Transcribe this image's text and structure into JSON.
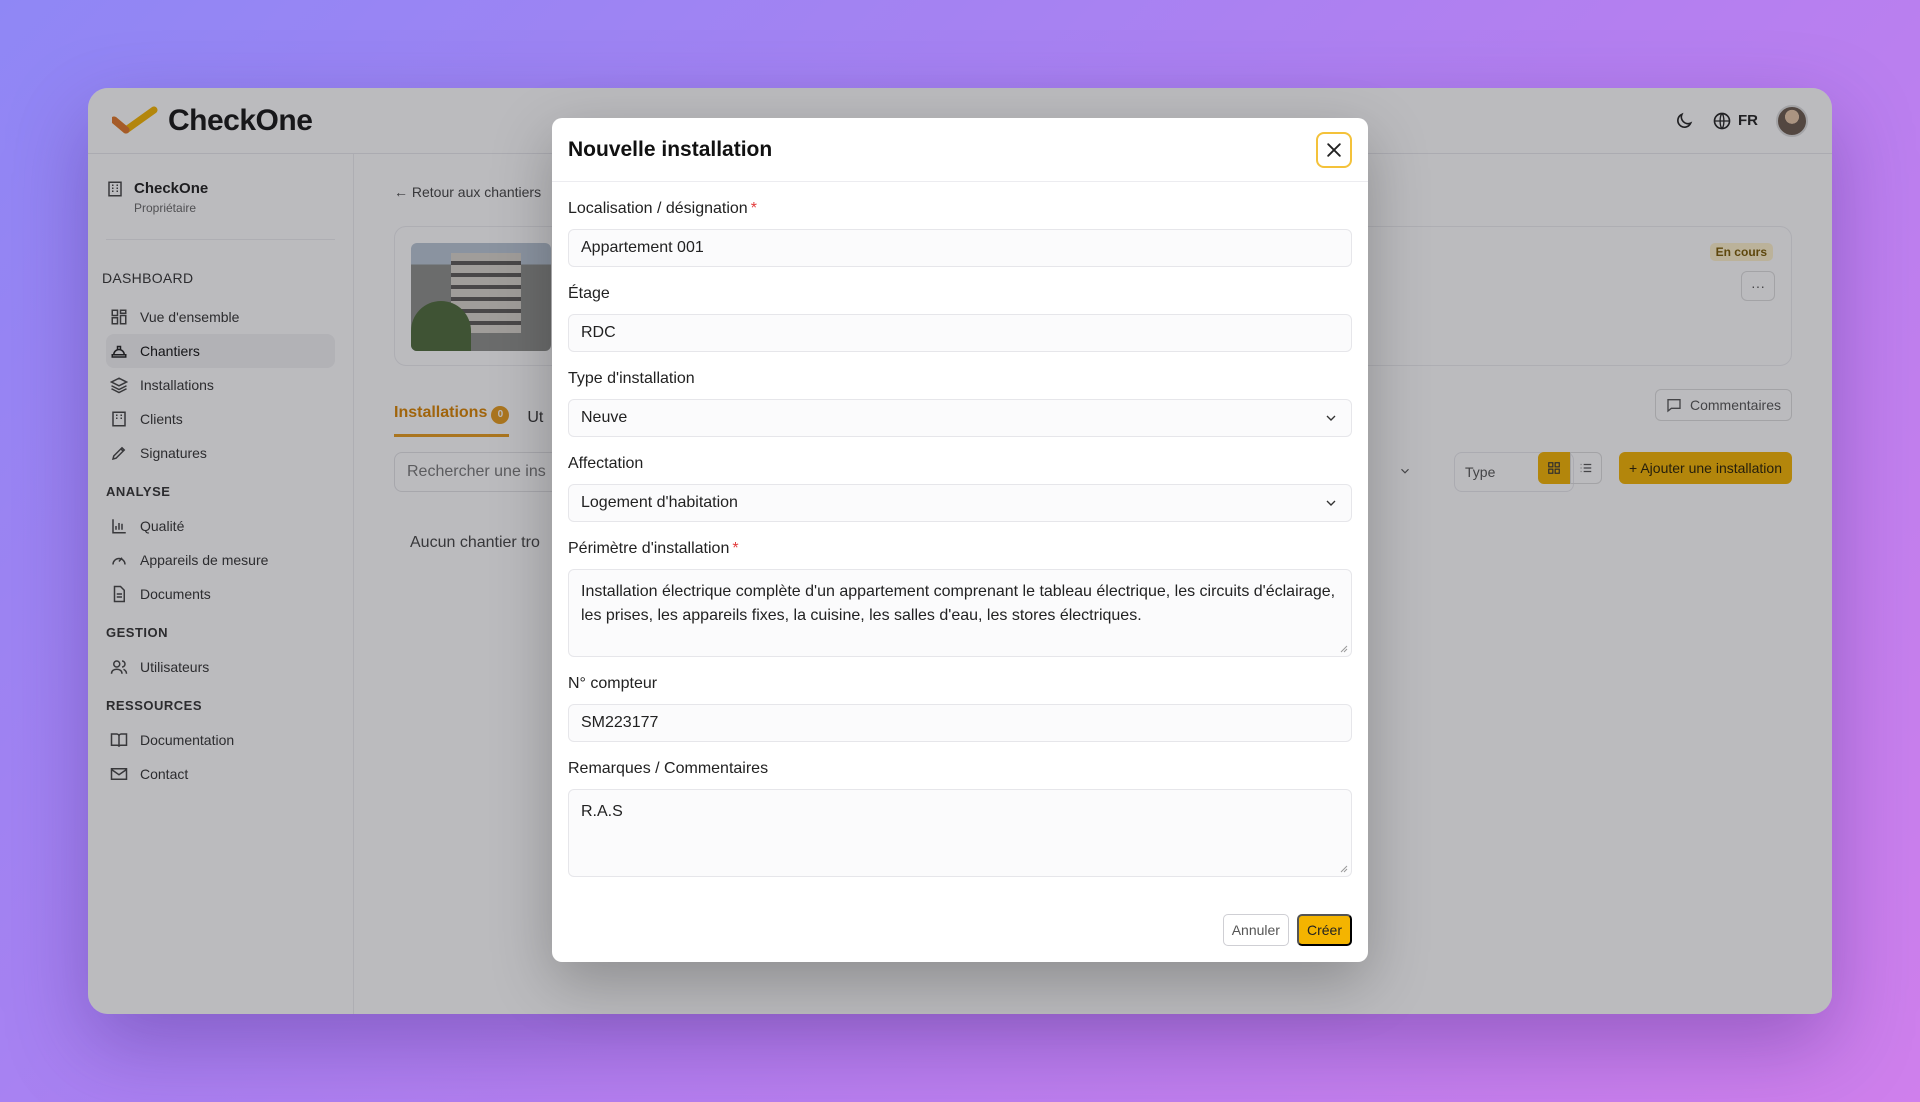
{
  "app": {
    "name": "CheckOne",
    "language": "FR"
  },
  "org": {
    "name": "CheckOne",
    "role": "Propriétaire"
  },
  "sidebar": {
    "sections": [
      {
        "title": "DASHBOARD",
        "items": [
          {
            "label": "Vue d'ensemble",
            "icon": "grid-icon"
          },
          {
            "label": "Chantiers",
            "icon": "hard-hat-icon",
            "active": true
          },
          {
            "label": "Installations",
            "icon": "layers-icon"
          },
          {
            "label": "Clients",
            "icon": "building-icon"
          },
          {
            "label": "Signatures",
            "icon": "pen-icon"
          }
        ]
      },
      {
        "title": "ANALYSE",
        "items": [
          {
            "label": "Qualité",
            "icon": "bar-chart-icon"
          },
          {
            "label": "Appareils de mesure",
            "icon": "gauge-icon"
          },
          {
            "label": "Documents",
            "icon": "file-icon"
          }
        ]
      },
      {
        "title": "GESTION",
        "items": [
          {
            "label": "Utilisateurs",
            "icon": "users-icon"
          }
        ]
      },
      {
        "title": "RESSOURCES",
        "items": [
          {
            "label": "Documentation",
            "icon": "book-icon"
          },
          {
            "label": "Contact",
            "icon": "mail-icon"
          }
        ]
      }
    ]
  },
  "main": {
    "back_link": "← Retour aux chantiers",
    "status_badge": "En cours",
    "more_label": "···",
    "tabs": [
      {
        "label": "Installations",
        "count": "0"
      },
      {
        "label": "Ut"
      }
    ],
    "comments_label": "Commentaires",
    "search_placeholder": "Rechercher une ins",
    "type_filter": "Type",
    "add_button": "+ Ajouter une installation",
    "empty_text": "Aucun chantier tro"
  },
  "modal": {
    "title": "Nouvelle installation",
    "fields": {
      "location": {
        "label": "Localisation / désignation",
        "required": "*",
        "value": "Appartement 001"
      },
      "floor": {
        "label": "Étage",
        "value": "RDC"
      },
      "type": {
        "label": "Type d'installation",
        "value": "Neuve"
      },
      "usage": {
        "label": "Affectation",
        "value": "Logement d'habitation"
      },
      "scope": {
        "label": "Périmètre d'installation",
        "required": "*",
        "value": "Installation électrique complète d'un appartement comprenant le tableau électrique, les circuits d'éclairage, les prises, les appareils fixes, la cuisine, les salles d'eau, les stores électriques."
      },
      "meter": {
        "label": "N° compteur",
        "value": "SM223177"
      },
      "remarks": {
        "label": "Remarques / Commentaires",
        "value": "R.A.S"
      }
    },
    "cancel_label": "Annuler",
    "create_label": "Créer"
  },
  "colors": {
    "accent": "#f4b400",
    "tab_active": "#d98300",
    "required": "#e23b3b"
  }
}
